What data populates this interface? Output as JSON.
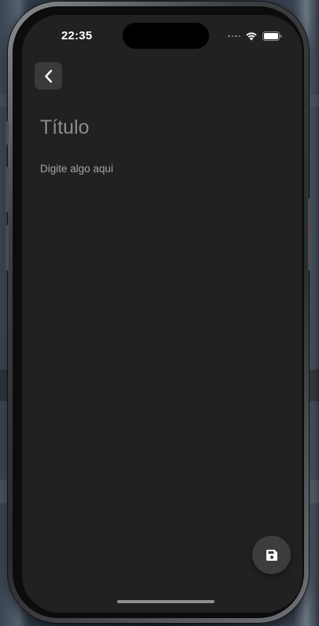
{
  "status_bar": {
    "time": "22:35",
    "icons": [
      "signal-dots-icon",
      "wifi-icon",
      "battery-icon"
    ]
  },
  "toolbar": {
    "back_icon": "chevron-left-icon"
  },
  "editor": {
    "title_placeholder": "Título",
    "body_placeholder": "Digite algo aqui"
  },
  "fab": {
    "icon": "save-icon"
  },
  "colors": {
    "screen_background": "#212121",
    "button_background": "#3a3a3a",
    "placeholder_text": "#8c8c8c"
  }
}
